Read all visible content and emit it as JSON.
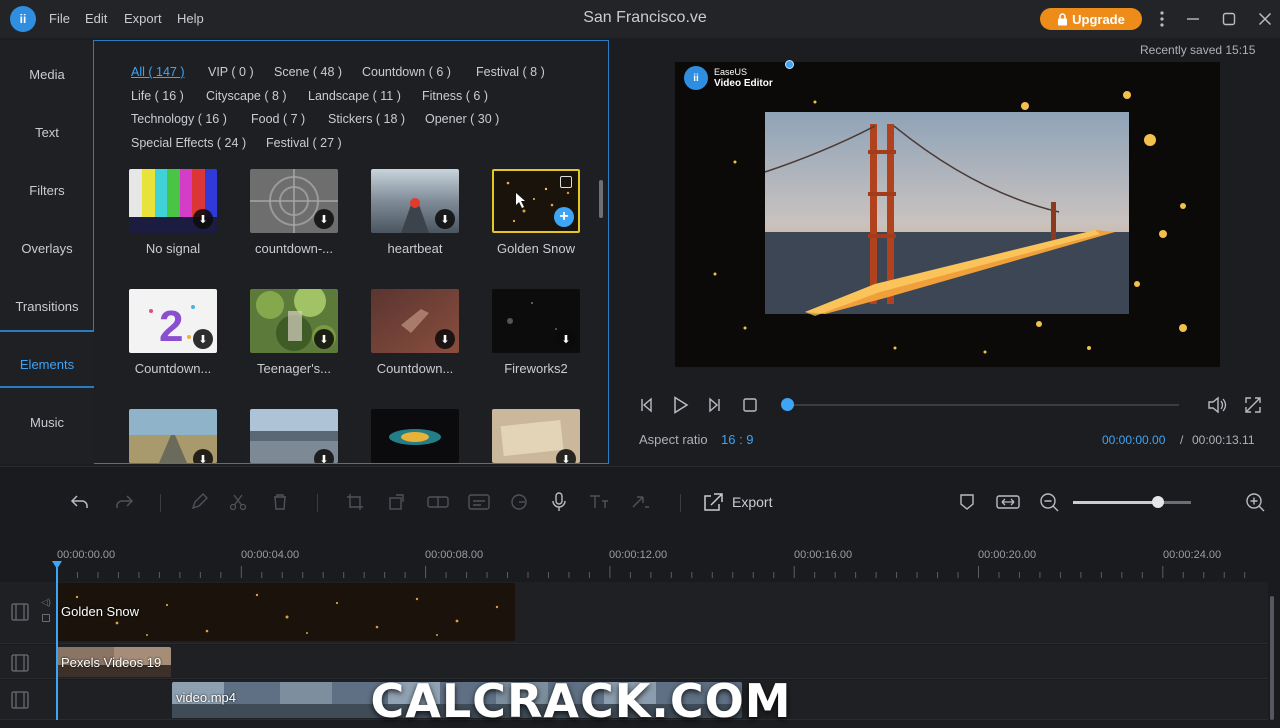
{
  "app": {
    "logo_text": "ii",
    "menu": [
      "File",
      "Edit",
      "Export",
      "Help"
    ],
    "window_title": "San Francisco.ve",
    "upgrade_label": "Upgrade"
  },
  "sidebar": {
    "items": [
      "Media",
      "Text",
      "Filters",
      "Overlays",
      "Transitions",
      "Elements",
      "Music"
    ],
    "active": "Elements"
  },
  "library": {
    "filters": [
      "All ( 147 )",
      "VIP ( 0 )",
      "Scene ( 48 )",
      "Countdown ( 6 )",
      "Festival ( 8 )",
      "Life ( 16 )",
      "Cityscape ( 8 )",
      "Landscape ( 11 )",
      "Fitness ( 6 )",
      "Technology ( 16 )",
      "Food ( 7 )",
      "Stickers ( 18 )",
      "Opener ( 30 )",
      "Special Effects ( 24 )",
      "Festival ( 27 )"
    ],
    "items": [
      {
        "label": "No signal"
      },
      {
        "label": "countdown-..."
      },
      {
        "label": "heartbeat"
      },
      {
        "label": "Golden Snow"
      },
      {
        "label": "Countdown..."
      },
      {
        "label": "Teenager's..."
      },
      {
        "label": "Countdown..."
      },
      {
        "label": "Fireworks2"
      }
    ],
    "selected_item": "Golden Snow"
  },
  "preview": {
    "recently_saved": "Recently saved 15:15",
    "watermark_line1": "EaseUS",
    "watermark_line2": "Video Editor",
    "aspect_label": "Aspect ratio",
    "aspect_value": "16 : 9",
    "time_current": "00:00:00.00",
    "time_separator": "/",
    "time_total": "00:00:13.11",
    "progress": 0.0
  },
  "toolbar": {
    "export_label": "Export",
    "zoom_level": 0.72
  },
  "timeline": {
    "ruler": [
      "00:00:00.00",
      "00:00:04.00",
      "00:00:08.00",
      "00:00:12.00",
      "00:00:16.00",
      "00:00:20.00",
      "00:00:24.00"
    ],
    "clips": [
      {
        "label": "Golden Snow"
      },
      {
        "label": "Pexels Videos 19"
      },
      {
        "label": "video.mp4"
      }
    ]
  },
  "watermark_site": "CALCRACK.COM",
  "colors": {
    "accent": "#3ea4f5",
    "upgrade": "#ee8c1a",
    "selection": "#e2c62a"
  }
}
